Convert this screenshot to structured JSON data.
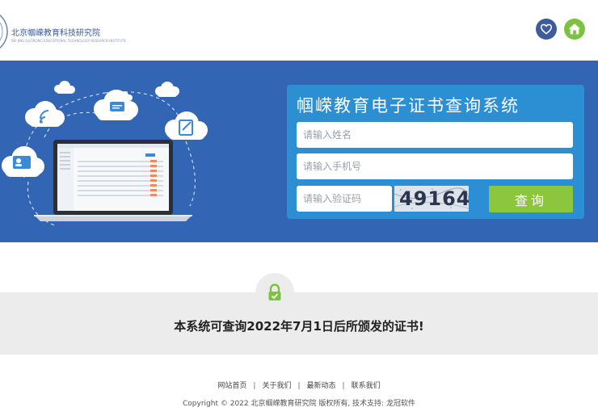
{
  "header": {
    "logo_name": "北京帼嵘教育科技研究院",
    "logo_en": "BEI JING GUORONG EDUCATIONAL TECHNOLOGY RESEARCH INSTITUTE",
    "icons": [
      "heart-icon",
      "home-icon"
    ],
    "colors": {
      "heart_bg": "#3e5b9b",
      "home_bg": "#7cc242"
    }
  },
  "banner": {
    "background": "#3266b4",
    "panel_title": "帼嵘教育电子证书查询系统",
    "name_placeholder": "请输入姓名",
    "phone_placeholder": "请输入手机号",
    "code_placeholder": "请输入验证码",
    "captcha_text": "49164",
    "query_label": "查询"
  },
  "notice": {
    "text": "本系统可查询2022年7月1日后所颁发的证书!"
  },
  "footer": {
    "links": [
      "网站首页",
      "关于我们",
      "最新动态",
      "联系我们"
    ],
    "copyright": "Copyright © 2022 北京帼嵘教育研究院 版权所有, 技术支持: 龙冠软件"
  }
}
